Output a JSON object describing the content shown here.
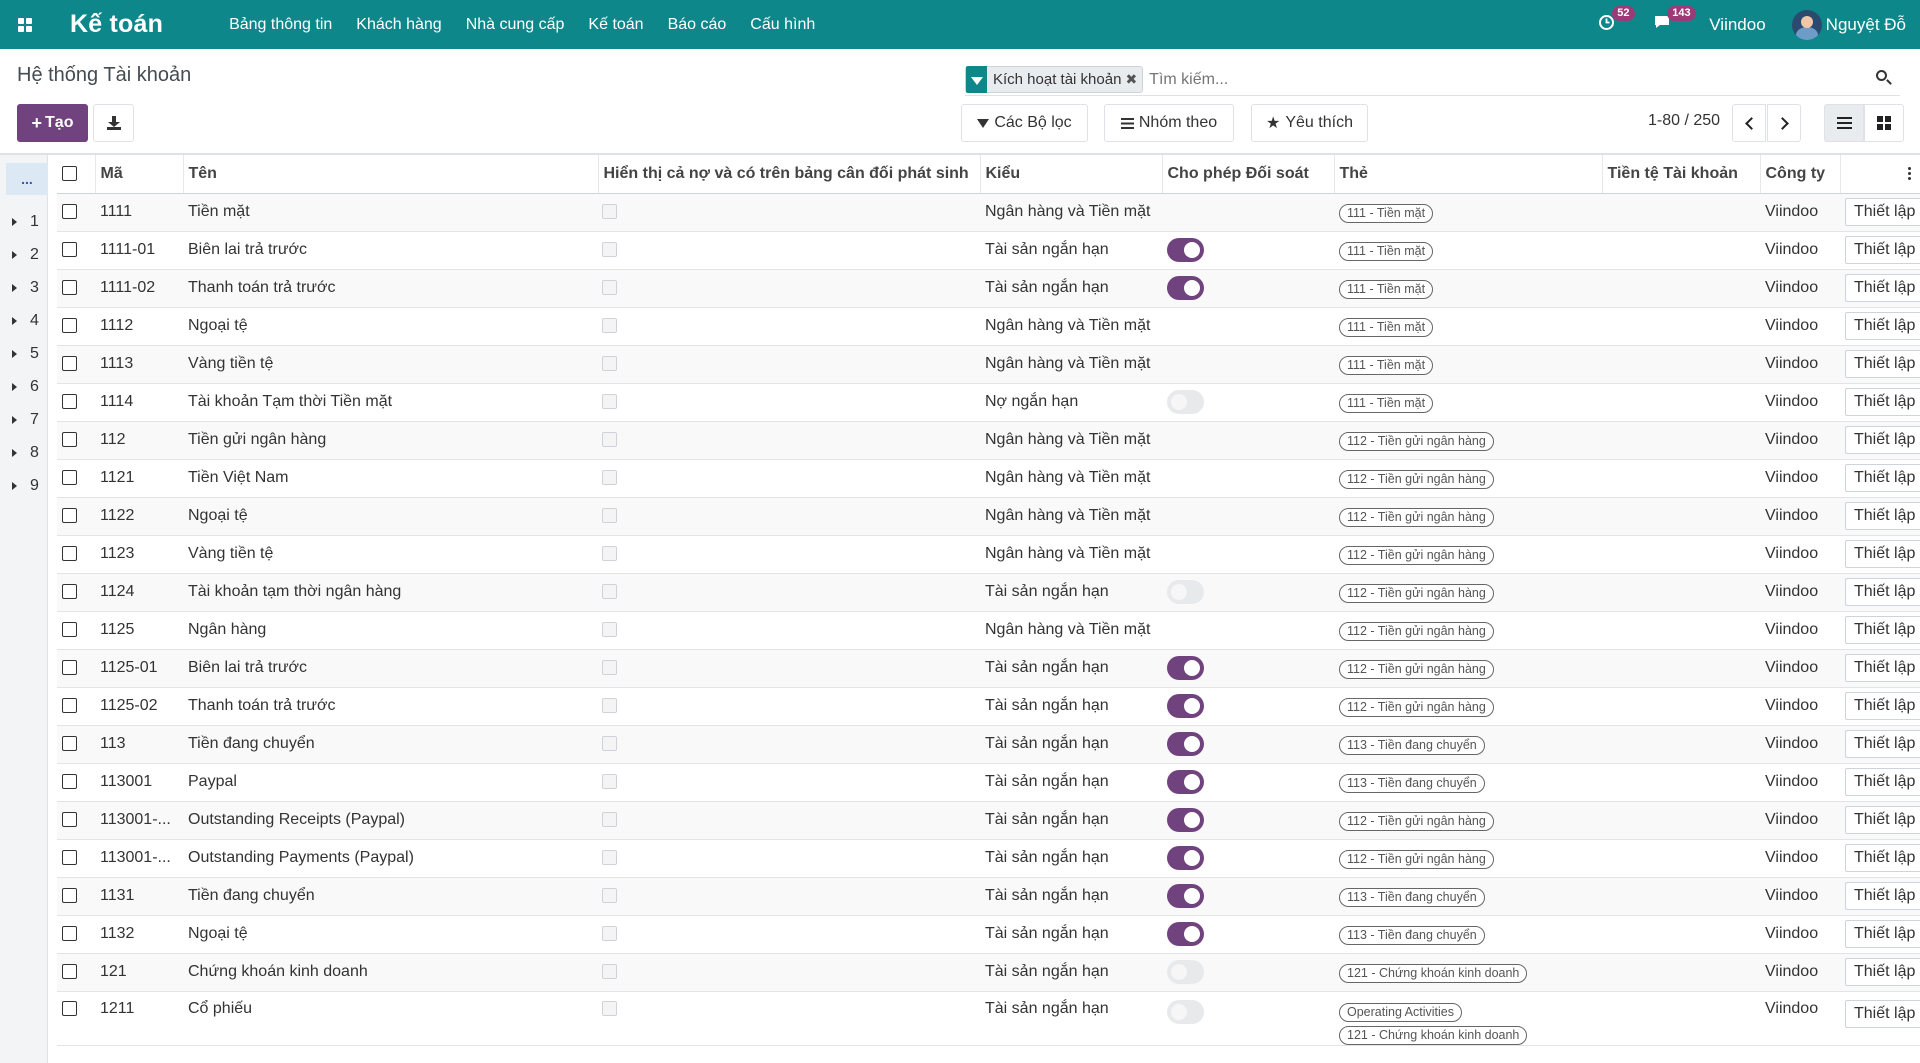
{
  "app": {
    "name": "Kế toán"
  },
  "nav": {
    "menu": [
      "Bảng thông tin",
      "Khách hàng",
      "Nhà cung cấp",
      "Kế toán",
      "Báo cáo",
      "Cấu hình"
    ],
    "activities_badge": "52",
    "messages_badge": "143",
    "company": "Viindoo",
    "user_name": "Nguyệt Đỗ"
  },
  "page": {
    "title": "Hệ thống Tài khoản"
  },
  "search": {
    "facet_label": "Kích hoạt tài khoản",
    "placeholder": "Tìm kiếm..."
  },
  "toolbar": {
    "create_label": "Tạo",
    "filters_label": "Các Bộ lọc",
    "groupby_label": "Nhóm theo",
    "favorites_label": "Yêu thích"
  },
  "pager": {
    "value": "1-80 / 250"
  },
  "groups": {
    "header": "...",
    "items": [
      "1",
      "2",
      "3",
      "4",
      "5",
      "6",
      "7",
      "8",
      "9"
    ]
  },
  "table": {
    "columns": [
      "Mã",
      "Tên",
      "Hiển thị cả nợ và có trên bảng cân đối phát sinh",
      "Kiểu",
      "Cho phép Đối soát",
      "Thẻ",
      "Tiền tệ Tài khoản",
      "Công ty"
    ],
    "button_label": "Thiết lập",
    "colors": {
      "toggle_on": "#71437e",
      "navbar": "#0e878b"
    },
    "rows": [
      {
        "code": "1111",
        "name": "Tiền mặt",
        "type": "Ngân hàng và Tiền mặt",
        "reconcile": null,
        "tags": [
          "111 - Tiền mặt"
        ],
        "company": "Viindoo"
      },
      {
        "code": "1111-01",
        "name": "Biên lai trả trước",
        "type": "Tài sản ngắn hạn",
        "reconcile": true,
        "tags": [
          "111 - Tiền mặt"
        ],
        "company": "Viindoo"
      },
      {
        "code": "1111-02",
        "name": "Thanh toán trả trước",
        "type": "Tài sản ngắn hạn",
        "reconcile": true,
        "tags": [
          "111 - Tiền mặt"
        ],
        "company": "Viindoo"
      },
      {
        "code": "1112",
        "name": "Ngoại tệ",
        "type": "Ngân hàng và Tiền mặt",
        "reconcile": null,
        "tags": [
          "111 - Tiền mặt"
        ],
        "company": "Viindoo"
      },
      {
        "code": "1113",
        "name": "Vàng tiền tệ",
        "type": "Ngân hàng và Tiền mặt",
        "reconcile": null,
        "tags": [
          "111 - Tiền mặt"
        ],
        "company": "Viindoo"
      },
      {
        "code": "1114",
        "name": "Tài khoản Tạm thời Tiền mặt",
        "type": "Nợ ngắn hạn",
        "reconcile": false,
        "tags": [
          "111 - Tiền mặt"
        ],
        "company": "Viindoo"
      },
      {
        "code": "112",
        "name": "Tiền gửi ngân hàng",
        "type": "Ngân hàng và Tiền mặt",
        "reconcile": null,
        "tags": [
          "112 - Tiền gửi ngân hàng"
        ],
        "company": "Viindoo"
      },
      {
        "code": "1121",
        "name": "Tiền Việt Nam",
        "type": "Ngân hàng và Tiền mặt",
        "reconcile": null,
        "tags": [
          "112 - Tiền gửi ngân hàng"
        ],
        "company": "Viindoo"
      },
      {
        "code": "1122",
        "name": "Ngoại tệ",
        "type": "Ngân hàng và Tiền mặt",
        "reconcile": null,
        "tags": [
          "112 - Tiền gửi ngân hàng"
        ],
        "company": "Viindoo"
      },
      {
        "code": "1123",
        "name": "Vàng tiền tệ",
        "type": "Ngân hàng và Tiền mặt",
        "reconcile": null,
        "tags": [
          "112 - Tiền gửi ngân hàng"
        ],
        "company": "Viindoo"
      },
      {
        "code": "1124",
        "name": "Tài khoản tạm thời ngân hàng",
        "type": "Tài sản ngắn hạn",
        "reconcile": false,
        "tags": [
          "112 - Tiền gửi ngân hàng"
        ],
        "company": "Viindoo"
      },
      {
        "code": "1125",
        "name": "Ngân hàng",
        "type": "Ngân hàng và Tiền mặt",
        "reconcile": null,
        "tags": [
          "112 - Tiền gửi ngân hàng"
        ],
        "company": "Viindoo"
      },
      {
        "code": "1125-01",
        "name": "Biên lai trả trước",
        "type": "Tài sản ngắn hạn",
        "reconcile": true,
        "tags": [
          "112 - Tiền gửi ngân hàng"
        ],
        "company": "Viindoo"
      },
      {
        "code": "1125-02",
        "name": "Thanh toán trả trước",
        "type": "Tài sản ngắn hạn",
        "reconcile": true,
        "tags": [
          "112 - Tiền gửi ngân hàng"
        ],
        "company": "Viindoo"
      },
      {
        "code": "113",
        "name": "Tiền đang chuyển",
        "type": "Tài sản ngắn hạn",
        "reconcile": true,
        "tags": [
          "113 - Tiền đang chuyển"
        ],
        "company": "Viindoo"
      },
      {
        "code": "113001",
        "name": "Paypal",
        "type": "Tài sản ngắn hạn",
        "reconcile": true,
        "tags": [
          "113 - Tiền đang chuyển"
        ],
        "company": "Viindoo"
      },
      {
        "code": "113001-...",
        "name": "Outstanding Receipts (Paypal)",
        "type": "Tài sản ngắn hạn",
        "reconcile": true,
        "tags": [
          "112 - Tiền gửi ngân hàng"
        ],
        "company": "Viindoo"
      },
      {
        "code": "113001-...",
        "name": "Outstanding Payments (Paypal)",
        "type": "Tài sản ngắn hạn",
        "reconcile": true,
        "tags": [
          "112 - Tiền gửi ngân hàng"
        ],
        "company": "Viindoo"
      },
      {
        "code": "1131",
        "name": "Tiền đang chuyển",
        "type": "Tài sản ngắn hạn",
        "reconcile": true,
        "tags": [
          "113 - Tiền đang chuyển"
        ],
        "company": "Viindoo"
      },
      {
        "code": "1132",
        "name": "Ngoại tệ",
        "type": "Tài sản ngắn hạn",
        "reconcile": true,
        "tags": [
          "113 - Tiền đang chuyển"
        ],
        "company": "Viindoo"
      },
      {
        "code": "121",
        "name": "Chứng khoán kinh doanh",
        "type": "Tài sản ngắn hạn",
        "reconcile": false,
        "tags": [
          "121 - Chứng khoán kinh doanh"
        ],
        "company": "Viindoo"
      },
      {
        "code": "1211",
        "name": "Cổ phiếu",
        "type": "Tài sản ngắn hạn",
        "reconcile": false,
        "tags": [
          "Operating Activities",
          "121 - Chứng khoán kinh doanh"
        ],
        "company": "Viindoo"
      }
    ]
  }
}
